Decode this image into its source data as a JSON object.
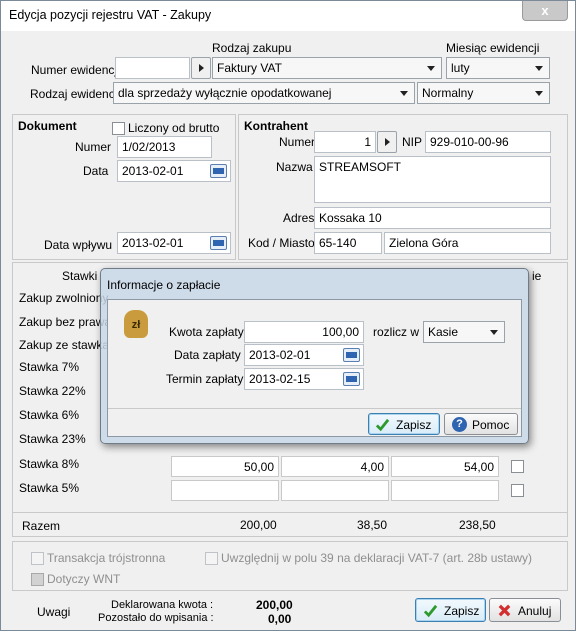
{
  "window": {
    "title": "Edycja pozycji rejestru VAT - Zakupy",
    "close_glyph": "x"
  },
  "header": {
    "rodzaj_zakupu_label": "Rodzaj zakupu",
    "miesiac_label": "Miesiąc ewidencji",
    "numer_ewidencji_label": "Numer ewidencji",
    "numer_ewidencji_value": "",
    "rodzaj_zakupu_value": "Faktury VAT",
    "miesiac_value": "luty",
    "rodzaj_ewidencji_label": "Rodzaj ewidencji",
    "rodzaj_ewidencji_value": "dla sprzedaży wyłącznie opodatkowanej",
    "typ_value": "Normalny"
  },
  "dokument": {
    "section_label": "Dokument",
    "liczony_label": "Liczony od brutto",
    "numer_label": "Numer",
    "numer_value": "1/02/2013",
    "data_label": "Data",
    "data_value": "2013-02-01",
    "data_wplywu_label": "Data wpływu",
    "data_wplywu_value": "2013-02-01"
  },
  "kontrahent": {
    "section_label": "Kontrahent",
    "numer_label": "Numer",
    "numer_value": "1",
    "nip_label": "NIP",
    "nip_value": "929-010-00-96",
    "nazwa_label": "Nazwa",
    "nazwa_value": "STREAMSOFT",
    "adres_label": "Adres",
    "adres_value": "Kossaka 10",
    "kod_label": "Kod / Miasto",
    "kod_value": "65-140",
    "miasto_value": "Zielona Góra"
  },
  "stawki": {
    "header_label": "Stawki",
    "header_tail": "ie",
    "rows": [
      {
        "label": "Zakup zwolniony"
      },
      {
        "label": "Zakup bez prawa"
      },
      {
        "label": "Zakup ze stawką"
      },
      {
        "label": "Stawka 7%"
      },
      {
        "label": "Stawka 22%"
      },
      {
        "label": "Stawka 6%"
      },
      {
        "label": "Stawka 23%"
      },
      {
        "label": "Stawka 8%",
        "netto": "50,00",
        "vat": "4,00",
        "brutto": "54,00"
      },
      {
        "label": "Stawka 5%",
        "netto": "",
        "vat": "",
        "brutto": ""
      }
    ],
    "razem_label": "Razem",
    "razem_netto": "200,00",
    "razem_vat": "38,50",
    "razem_brutto": "238,50"
  },
  "options": {
    "transakcja_label": "Transakcja trójstronna",
    "uwzglednij_label": "Uwzględnij w polu 39 na deklaracji VAT-7 (art. 28b ustawy)",
    "dotyczy_label": "Dotyczy WNT"
  },
  "footer": {
    "uwagi_label": "Uwagi",
    "deklarowana_label": "Deklarowana kwota :",
    "deklarowana_value": "200,00",
    "pozostalo_label": "Pozostało do wpisania :",
    "pozostalo_value": "0,00",
    "zapisz_label": "Zapisz",
    "anuluj_label": "Anuluj"
  },
  "dialog": {
    "title": "Informacje o zapłacie",
    "icon_text": "zł",
    "kwota_label": "Kwota zapłaty",
    "kwota_value": "100,00",
    "rozlicz_label": "rozlicz w",
    "rozlicz_value": "Kasie",
    "data_label": "Data zapłaty",
    "data_value": "2013-02-01",
    "termin_label": "Termin zapłaty",
    "termin_value": "2013-02-15",
    "zapisz_label": "Zapisz",
    "pomoc_label": "Pomoc"
  },
  "colors": {
    "accent": "#3c7fb1",
    "ok_green": "#2e9a2e",
    "cancel_red": "#d23030"
  }
}
